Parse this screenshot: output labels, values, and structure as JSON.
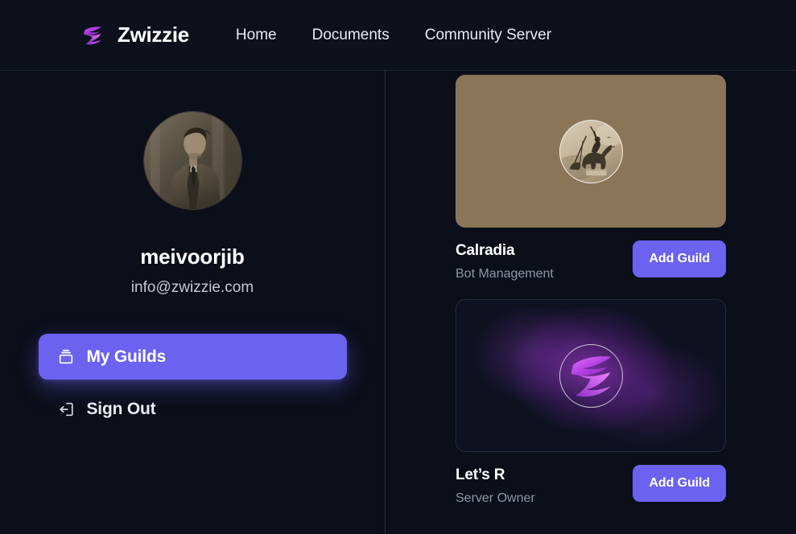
{
  "header": {
    "brand_name": "Zwizzie",
    "logo_icon": "zwizzie-bolt-logo",
    "nav": [
      {
        "label": "Home",
        "icon": ""
      },
      {
        "label": "Documents",
        "icon": ""
      },
      {
        "label": "Community Server",
        "icon": ""
      }
    ]
  },
  "sidebar": {
    "avatar_icon": "user-photo-avatar",
    "profile_name": "meivoorjib",
    "profile_email": "info@zwizzie.com",
    "menu": [
      {
        "label": "My Guilds",
        "icon": "archive-box-icon",
        "active": true
      },
      {
        "label": "Sign Out",
        "icon": "logout-icon",
        "active": false
      }
    ]
  },
  "main": {
    "guilds": [
      {
        "name": "Calradia",
        "role": "Bot Management",
        "button_label": "Add Guild",
        "banner_style": "sepia",
        "avatar_icon": "knight-on-horseback-avatar"
      },
      {
        "name": "Let’s R",
        "role": "Server Owner",
        "button_label": "Add Guild",
        "banner_style": "purple",
        "avatar_icon": "zwizzie-bolt-logo"
      }
    ]
  },
  "colors": {
    "page_background": "#0b0f1a",
    "header_background": "#0c111c",
    "accent": "#6b62f0",
    "text_primary": "#ffffff",
    "text_secondary": "#8e95a6",
    "divider": "#232a3c"
  }
}
